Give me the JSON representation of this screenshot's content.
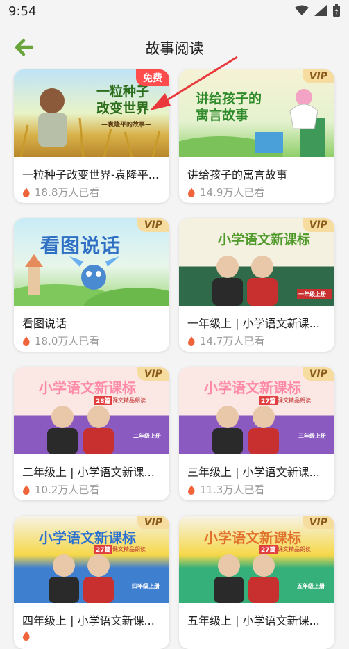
{
  "status": {
    "time": "9:54"
  },
  "header": {
    "title": "故事阅读"
  },
  "colors": {
    "accent": "#6aa53c",
    "badge_free": "#ff4d4d",
    "badge_vip": "#f7dca0",
    "flame": "#f0643c"
  },
  "cards": [
    {
      "title": "一粒种子改变世界-袁隆平...",
      "views": "18.8万人已看",
      "badge": "免费",
      "thumb_title": "一粒种子改变世界",
      "thumb_sub": "—袁隆平的故事—"
    },
    {
      "title": "讲给孩子的寓言故事",
      "views": "14.9万人已看",
      "badge": "VIP",
      "thumb_title": "讲给孩子的寓言故事"
    },
    {
      "title": "看图说话",
      "views": "18.0万人已看",
      "badge": "VIP",
      "thumb_title": "看图说话"
    },
    {
      "title": "一年级上 | 小学语文新课...",
      "views": "14.7万人已看",
      "badge": "VIP",
      "thumb_title": "小学语文新课标",
      "thumb_grade": "一年级上册"
    },
    {
      "title": "二年级上 | 小学语文新课...",
      "views": "10.2万人已看",
      "badge": "VIP",
      "thumb_title": "小学语文新课标",
      "thumb_count": "28篇",
      "thumb_sub": "课文精品朗读",
      "thumb_grade": "二年级上册"
    },
    {
      "title": "三年级上 | 小学语文新课...",
      "views": "11.3万人已看",
      "badge": "VIP",
      "thumb_title": "小学语文新课标",
      "thumb_count": "27篇",
      "thumb_sub": "课文精品朗读",
      "thumb_grade": "三年级上册"
    },
    {
      "title": "四年级上 | 小学语文新课...",
      "views": "",
      "badge": "VIP",
      "thumb_title": "小学语文新课标",
      "thumb_count": "27篇",
      "thumb_sub": "课文精品朗读",
      "thumb_grade": "四年级上册"
    },
    {
      "title": "五年级上 | 小学语文新课...",
      "views": "",
      "badge": "VIP",
      "thumb_title": "小学语文新课标",
      "thumb_count": "27篇",
      "thumb_sub": "课文精品朗读",
      "thumb_grade": "五年级上册"
    }
  ]
}
